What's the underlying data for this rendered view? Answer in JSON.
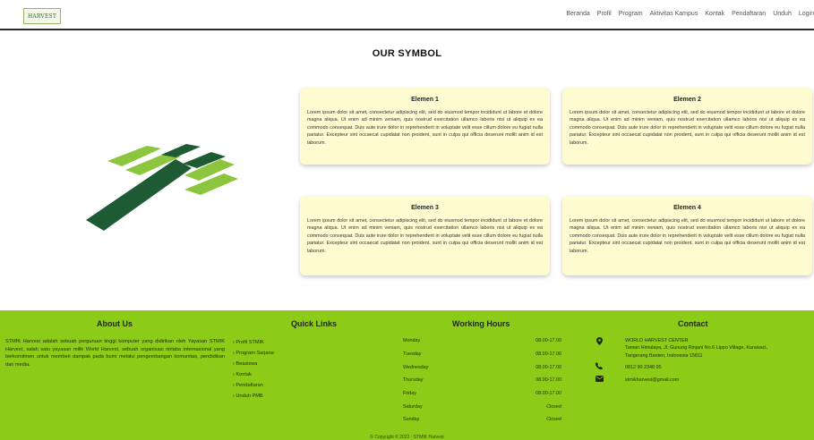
{
  "nav": {
    "logo_text": "HARVEST",
    "links": [
      "Beranda",
      "Profil",
      "Program",
      "Aktivitas Kampus",
      "Kontak",
      "Pendaftaran",
      "Unduh",
      "Login"
    ]
  },
  "symbol_section": {
    "title": "OUR SYMBOL",
    "cards": [
      {
        "title": "Elemen 1",
        "text": "Lorem ipsum dolor sit amet, consectetur adipiscing elit, sed do eiusmod tempor incididunt ut labore et dolore magna aliqua. Ut enim ad minim veniam, quis nostrud exercitation ullamco laboris nisi ut aliquip ex ea commodo consequat. Duis aute irure dolor in reprehenderit in voluptate velit esse cillum dolore eu fugiat nulla pariatur. Excepteur sint occaecat cupidatat non proident, sunt in culpa qui officia deserunt mollit anim id est laborum."
      },
      {
        "title": "Elemen 2",
        "text": "Lorem ipsum dolor sit amet, consectetur adipiscing elit, sed do eiusmod tempor incididunt ut labore et dolore magna aliqua. Ut enim ad minim veniam, quis nostrud exercitation ullamco laboris nisi ut aliquip ex ea commodo consequat. Duis aute irure dolor in reprehenderit in voluptate velit esse cillum dolore eu fugiat nulla pariatur. Excepteur sint occaecat cupidatat non proident, sunt in culpa qui officia deserunt mollit anim id est laborum."
      },
      {
        "title": "Elemen 3",
        "text": "Lorem ipsum dolor sit amet, consectetur adipiscing elit, sed do eiusmod tempor incididunt ut labore et dolore magna aliqua. Ut enim ad minim veniam, quis nostrud exercitation ullamco laboris nisi ut aliquip ex ea commodo consequat. Duis aute irure dolor in reprehenderit in voluptate velit esse cillum dolore eu fugiat nulla pariatur. Excepteur sint occaecat cupidatat non proident, sunt in culpa qui officia deserunt mollit anim id est laborum."
      },
      {
        "title": "Elemen 4",
        "text": "Lorem ipsum dolor sit amet, consectetur adipiscing elit, sed do eiusmod tempor incididunt ut labore et dolore magna aliqua. Ut enim ad minim veniam, quis nostrud exercitation ullamco laboris nisi ut aliquip ex ea commodo consequat. Duis aute irure dolor in reprehenderit in voluptate velit esse cillum dolore eu fugiat nulla pariatur. Excepteur sint occaecat cupidatat non proident, sunt in culpa qui officia deserunt mollit anim id est laborum."
      }
    ]
  },
  "footer": {
    "about": {
      "title": "About Us",
      "text": "STMIK Harvest adalah sebuah perguruan tinggi komputer yang didirikan oleh Yayasan STMIK Harvest, salah satu yayasan milik World Harvest, sebuah organisasi nirlaba internasional yang berkomitmen untuk memberi dampak pada bumi melalui pengembangan komunitas, pendidikan dan media."
    },
    "quick_links": {
      "title": "Quick Links",
      "items": [
        "Profil STMIK",
        "Program Sarjana",
        "Beasiswa",
        "Kontak",
        "Pendaftaran",
        "Unduh PMB"
      ]
    },
    "working_hours": {
      "title": "Working Hours",
      "rows": [
        {
          "day": "Monday",
          "time": "08.00-17.00"
        },
        {
          "day": "Tuesday",
          "time": "08.00-17.00"
        },
        {
          "day": "Wednesday",
          "time": "08.00-17.00"
        },
        {
          "day": "Thursday",
          "time": "08.00-17.00"
        },
        {
          "day": "Friday",
          "time": "08.00-17.00"
        },
        {
          "day": "Saturday",
          "time": "Closed"
        },
        {
          "day": "Sunday",
          "time": "Closed"
        }
      ]
    },
    "contact": {
      "title": "Contact",
      "address_name": "WORLD HARVEST CENTER",
      "address": "Taman Himalaya, Jl. Gunung Rinjani No.6 Lippo Village, Karawaci, Tangerang Banten, Indonesia 15811",
      "phone": "0812 90 2348 95",
      "email": "stmikharvest@gmail.com"
    },
    "copyright": "© Copyright © 2022 - STMIK Harvest"
  },
  "colors": {
    "footer_bg": "#8ccc18",
    "card_bg": "#fffbd1",
    "logo_dark_green": "#1e5a34",
    "logo_light_green": "#8cc63f"
  },
  "icons": [
    "map-marker-icon",
    "phone-icon",
    "envelope-icon"
  ]
}
